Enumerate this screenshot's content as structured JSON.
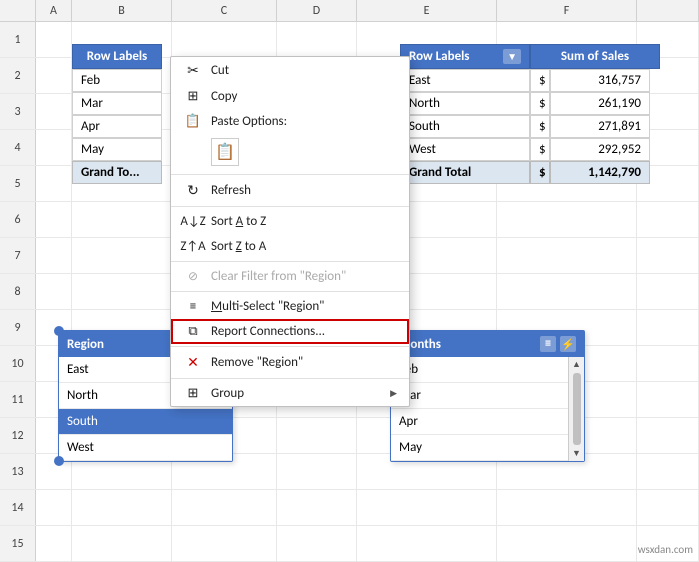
{
  "cols": {
    "headers": [
      "",
      "A",
      "B",
      "C",
      "D",
      "E",
      "F"
    ]
  },
  "rows": {
    "numbers": [
      1,
      2,
      3,
      4,
      5,
      6,
      7,
      8,
      9,
      10,
      11,
      12,
      13,
      14,
      15
    ]
  },
  "pivot1": {
    "header": "Row Labels",
    "rows": [
      {
        "label": "Feb",
        "value": ""
      },
      {
        "label": "Mar",
        "value": ""
      },
      {
        "label": "Apr",
        "value": ""
      },
      {
        "label": "May",
        "value": ""
      }
    ],
    "grand": "Grand To..."
  },
  "pivot2": {
    "header_label": "Row Labels",
    "header_filter": "▼",
    "header_value": "Sum of Sales",
    "rows": [
      {
        "label": "East",
        "cur": "$",
        "value": "316,757"
      },
      {
        "label": "North",
        "cur": "$",
        "value": "261,190"
      },
      {
        "label": "South",
        "cur": "$",
        "value": "271,891"
      },
      {
        "label": "West",
        "cur": "$",
        "value": "292,952"
      }
    ],
    "grand_label": "Grand Total",
    "grand_cur": "$",
    "grand_value": "1,142,790"
  },
  "slicer1": {
    "title": "Region",
    "items": [
      "East",
      "North",
      "South",
      "West"
    ],
    "selected": "South"
  },
  "slicer2": {
    "title": "Months",
    "items": [
      "Feb",
      "Mar",
      "Apr",
      "May"
    ]
  },
  "context_menu": {
    "items": [
      {
        "id": "cut",
        "icon": "✂",
        "label": "Cut",
        "disabled": false
      },
      {
        "id": "copy",
        "icon": "⧉",
        "label": "Copy",
        "disabled": false
      },
      {
        "id": "paste",
        "icon": "📋",
        "label": "Paste Options:",
        "disabled": false
      },
      {
        "id": "paste-icon",
        "icon": "📋",
        "label": "",
        "is_icon_only": true
      },
      {
        "id": "refresh",
        "icon": "↻",
        "label": "Refresh",
        "disabled": false
      },
      {
        "id": "sort-az",
        "icon": "↕",
        "label": "Sort A to Z",
        "disabled": false
      },
      {
        "id": "sort-za",
        "icon": "↕",
        "label": "Sort Z to A",
        "disabled": false
      },
      {
        "id": "clear-filter",
        "icon": "🚫",
        "label": "Clear Filter from \"Region\"",
        "disabled": true
      },
      {
        "id": "multi-select",
        "icon": "≡",
        "label": "Multi-Select \"Region\"",
        "disabled": false
      },
      {
        "id": "report-connections",
        "icon": "⧉",
        "label": "Report Connections...",
        "disabled": false,
        "highlighted": true
      },
      {
        "id": "remove",
        "icon": "✕",
        "label": "Remove \"Region\"",
        "disabled": false
      },
      {
        "id": "group",
        "icon": "⊞",
        "label": "Group",
        "has_arrow": true,
        "disabled": false
      }
    ]
  },
  "watermark": "wsxdan.com"
}
